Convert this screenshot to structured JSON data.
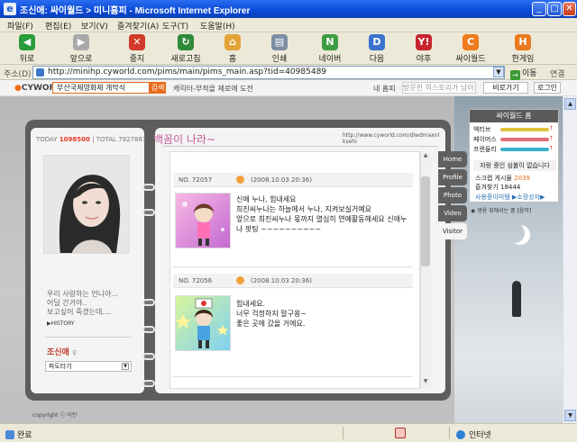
{
  "window": {
    "title": "조신애: 싸이월드 > 미니홈피 - Microsoft Internet Explorer"
  },
  "menu": [
    "파일(F)",
    "편집(E)",
    "보기(V)",
    "즐겨찾기(A)",
    "도구(T)",
    "도움말(H)"
  ],
  "toolbar": [
    {
      "label": "뒤로",
      "icon": "back-icon",
      "color": "#2a9b3a"
    },
    {
      "label": "앞으로",
      "icon": "forward-icon",
      "color": "#a9a9a9"
    },
    {
      "label": "중지",
      "icon": "stop-icon",
      "color": "#d23a2a"
    },
    {
      "label": "새로고침",
      "icon": "refresh-icon",
      "color": "#2f8a3a"
    },
    {
      "label": "홈",
      "icon": "home-icon",
      "color": "#e2a338"
    },
    {
      "label": "인쇄",
      "icon": "print-icon",
      "color": "#7c8ea3"
    },
    {
      "label": "네이버",
      "icon": "naver-icon",
      "color": "#3f9c41"
    },
    {
      "label": "다음",
      "icon": "daum-icon",
      "color": "#3c72cf"
    },
    {
      "label": "야후",
      "icon": "yahoo-icon",
      "color": "#c8242e"
    },
    {
      "label": "싸이월드",
      "icon": "cyworld-icon",
      "color": "#f07a1f"
    },
    {
      "label": "한게임",
      "icon": "hangame-icon",
      "color": "#e97a1f"
    }
  ],
  "address": {
    "label": "주소(D)",
    "url": "http://minihp.cyworld.com/pims/main/pims_main.asp?tid=40985489",
    "go": "이동",
    "links": "연결"
  },
  "cybar": {
    "logo": "CYWORLD",
    "search": "부산국제영화제 개막식",
    "search_btn": "검색",
    "promo": "캐릭터-부적을 제로에 도전",
    "myhome": "내 홈피",
    "visited": "방문한 히스토리가 남아요",
    "side_view": "비로가기",
    "logout": "로그인"
  },
  "profile": {
    "today_label": "TODAY",
    "today": "1098500",
    "total_label": "TOTAL",
    "total": "7927881",
    "intro": "우리 사랑하는 언니야...\n어딜 간거야..\n보고싶어 죽겠는데....",
    "history": "▶HISTORY",
    "name": "조신애",
    "gender": "♀",
    "surf": "파도타기"
  },
  "page": {
    "title": "백꼼이 나라~",
    "url": "http://www.cyworld.com/dlwdmaxnl\nksehi"
  },
  "posts": [
    {
      "no": "72057",
      "date": "(2008.10.03 20:36)",
      "text": "신애 누나, 힘내세요\n희진씨누나는 하늘에서 누나, 지켜보실거예요\n앞으로 희진씨누나 몫까지 열심히 연예활동해세요 신애누\n나 팟팅 ~~~~~~~~~~"
    },
    {
      "no": "72056",
      "date": "(2008.10.03 20:36)",
      "text": "힘내세요.\n너무 걱정하지 말구용~\n좋은 곳에 갔을 거에요."
    }
  ],
  "nav": [
    "Home",
    "Profile",
    "Photo",
    "Video",
    "Visitor"
  ],
  "mini": {
    "header": "싸이월드 홈",
    "bars": [
      {
        "label": "엑티브",
        "color": "#e0c23a"
      },
      {
        "label": "페이머스",
        "color": "#e06f7a"
      },
      {
        "label": "프렌들리",
        "color": "#3ab1c9"
      }
    ],
    "status": "자랑 중인 심볼이 없습니다",
    "scrap_label": "스크랩 게시물",
    "scrap": "2039",
    "fav_label": "즐겨찾기",
    "fav": "18444",
    "shop": "사용중이미템 ▶소장상자▶"
  },
  "bgm": "◉ 생용 위해서는 좀 [음악]",
  "copyright": "copyright ⓒ 아린",
  "status": {
    "left": "완료",
    "right": "인터넷"
  }
}
